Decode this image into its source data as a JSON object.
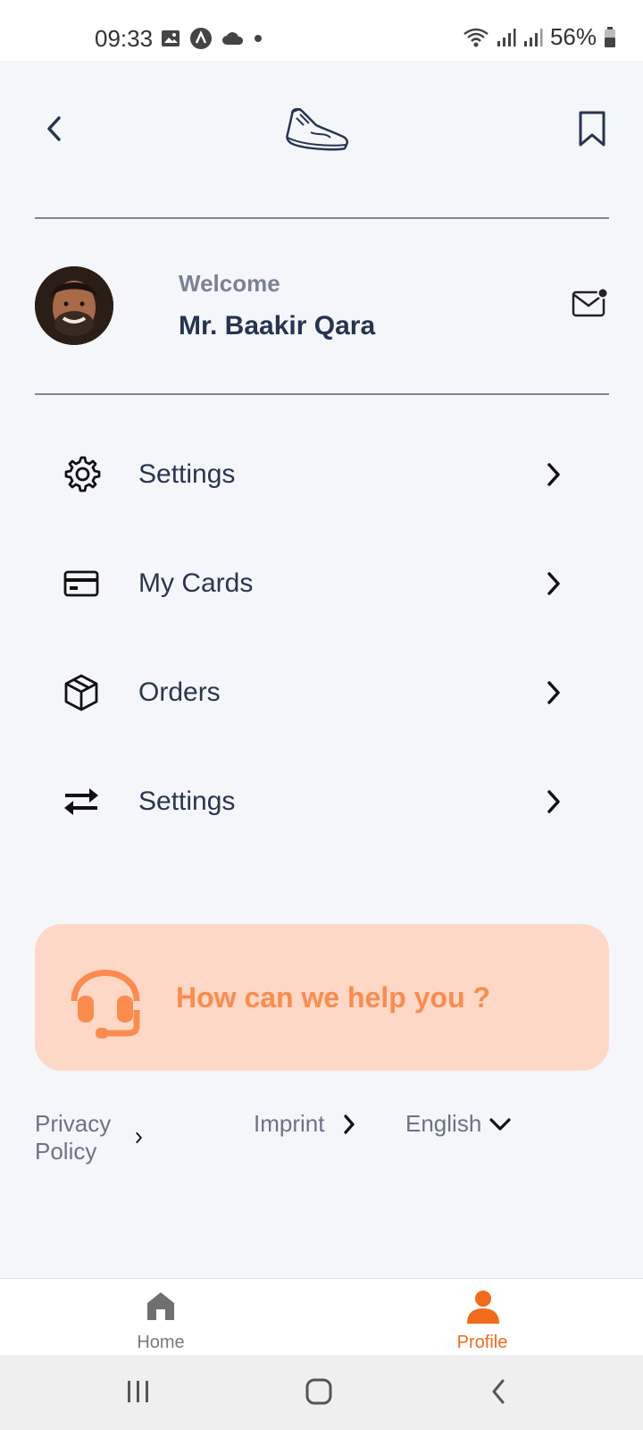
{
  "status_bar": {
    "time": "09:33",
    "battery": "56%"
  },
  "profile": {
    "welcome": "Welcome",
    "name": "Mr. Baakir Qara"
  },
  "menu": {
    "items": [
      {
        "label": "Settings",
        "icon": "gear-icon"
      },
      {
        "label": "My Cards",
        "icon": "card-icon"
      },
      {
        "label": "Orders",
        "icon": "box-icon"
      },
      {
        "label": "Settings",
        "icon": "swap-arrows-icon"
      }
    ]
  },
  "help": {
    "text": "How can we help you ?"
  },
  "footer": {
    "privacy": "Privacy Policy",
    "imprint": "Imprint",
    "language": "English"
  },
  "bottom_nav": {
    "home": "Home",
    "profile": "Profile"
  },
  "colors": {
    "accent": "#f26a1b",
    "help_bg": "#fdd8c6",
    "help_text": "#fb8c4e",
    "primary_text": "#2a3550",
    "muted_text": "#7b8195",
    "background": "#f4f6fa"
  }
}
